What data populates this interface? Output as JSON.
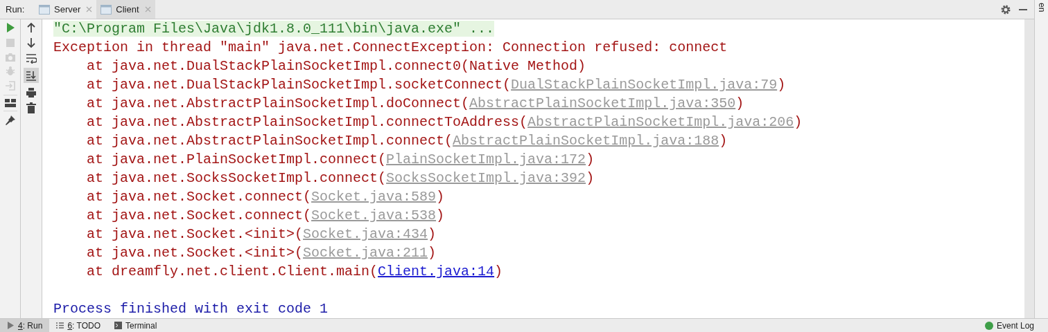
{
  "tool_window": {
    "label": "Run:",
    "tabs": [
      {
        "label": "Server",
        "selected": false
      },
      {
        "label": "Client",
        "selected": true
      }
    ]
  },
  "console": {
    "lines": [
      {
        "kind": "command",
        "text": "\"C:\\Program Files\\Java\\jdk1.8.0_111\\bin\\java.exe\" ..."
      },
      {
        "kind": "error",
        "text": "Exception in thread \"main\" java.net.ConnectException: Connection refused: connect"
      },
      {
        "kind": "trace",
        "text": "at java.net.DualStackPlainSocketImpl.connect0(Native Method)"
      },
      {
        "kind": "trace",
        "text": "at java.net.DualStackPlainSocketImpl.socketConnect(",
        "link": "DualStackPlainSocketImpl.java:79",
        "user_code": false,
        "tail": ")"
      },
      {
        "kind": "trace",
        "text": "at java.net.AbstractPlainSocketImpl.doConnect(",
        "link": "AbstractPlainSocketImpl.java:350",
        "user_code": false,
        "tail": ")"
      },
      {
        "kind": "trace",
        "text": "at java.net.AbstractPlainSocketImpl.connectToAddress(",
        "link": "AbstractPlainSocketImpl.java:206",
        "user_code": false,
        "tail": ")"
      },
      {
        "kind": "trace",
        "text": "at java.net.AbstractPlainSocketImpl.connect(",
        "link": "AbstractPlainSocketImpl.java:188",
        "user_code": false,
        "tail": ")"
      },
      {
        "kind": "trace",
        "text": "at java.net.PlainSocketImpl.connect(",
        "link": "PlainSocketImpl.java:172",
        "user_code": false,
        "tail": ")"
      },
      {
        "kind": "trace",
        "text": "at java.net.SocksSocketImpl.connect(",
        "link": "SocksSocketImpl.java:392",
        "user_code": false,
        "tail": ")"
      },
      {
        "kind": "trace",
        "text": "at java.net.Socket.connect(",
        "link": "Socket.java:589",
        "user_code": false,
        "tail": ")"
      },
      {
        "kind": "trace",
        "text": "at java.net.Socket.connect(",
        "link": "Socket.java:538",
        "user_code": false,
        "tail": ")"
      },
      {
        "kind": "trace",
        "text": "at java.net.Socket.<init>(",
        "link": "Socket.java:434",
        "user_code": false,
        "tail": ")"
      },
      {
        "kind": "trace",
        "text": "at java.net.Socket.<init>(",
        "link": "Socket.java:211",
        "user_code": false,
        "tail": ")"
      },
      {
        "kind": "trace",
        "text": "at dreamfly.net.client.Client.main(",
        "link": "Client.java:14",
        "user_code": true,
        "tail": ")"
      },
      {
        "kind": "blank"
      },
      {
        "kind": "process",
        "text": "Process finished with exit code 1"
      }
    ]
  },
  "right_strip": {
    "label": "en"
  },
  "status_bar": {
    "tabs": [
      {
        "mnemonic": "4",
        "label": ": Run",
        "selected": true
      },
      {
        "mnemonic": "6",
        "label": ": TODO",
        "selected": false
      },
      {
        "label": "Terminal",
        "selected": false
      }
    ],
    "event_log": {
      "label": "Event Log"
    }
  }
}
